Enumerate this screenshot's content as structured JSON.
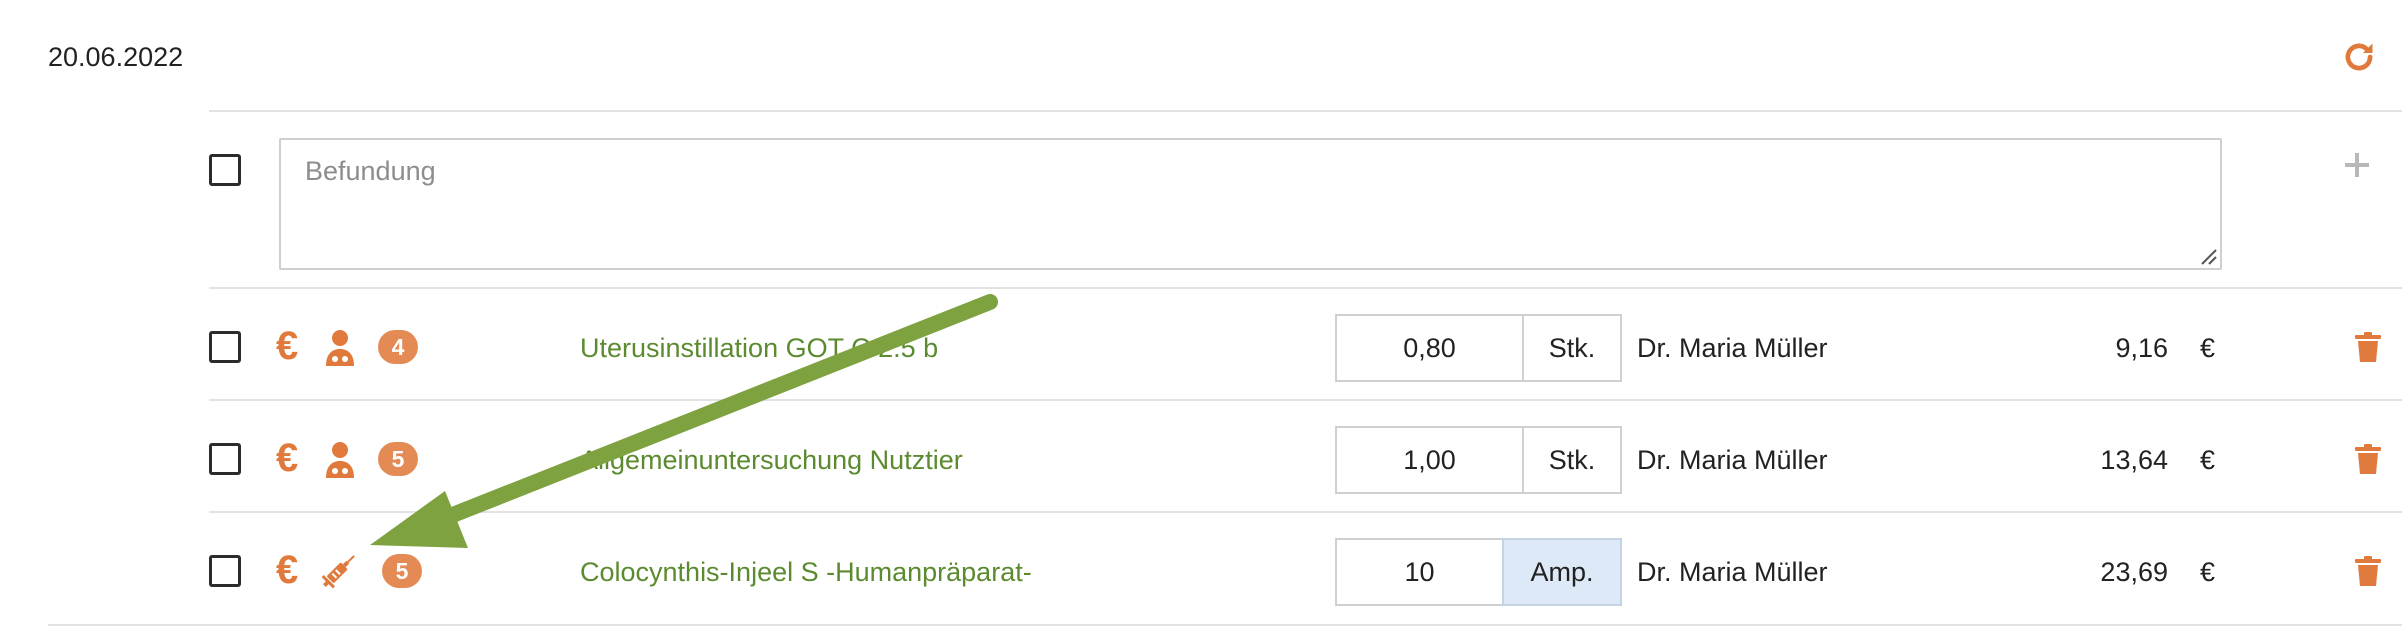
{
  "header": {
    "date": "20.06.2022",
    "refresh_icon": "refresh-icon"
  },
  "findings": {
    "placeholder": "Befundung",
    "value": "",
    "add_icon": "plus-icon"
  },
  "rows": [
    {
      "icons": [
        "euro-icon",
        "veterinarian-icon"
      ],
      "badge": "4",
      "name": "Uterusinstillation GOT C 2.5 b",
      "quantity": "0,80",
      "unit": "Stk.",
      "doctor": "Dr. Maria Müller",
      "price": "9,16",
      "currency": "€"
    },
    {
      "icons": [
        "euro-icon",
        "veterinarian-icon"
      ],
      "badge": "5",
      "name": "Allgemeinuntersuchung Nutztier",
      "quantity": "1,00",
      "unit": "Stk.",
      "doctor": "Dr. Maria Müller",
      "price": "13,64",
      "currency": "€"
    },
    {
      "icons": [
        "euro-icon",
        "syringe-icon"
      ],
      "badge": "5",
      "name": "Colocynthis-Injeel S -Humanpräparat-",
      "quantity": "10",
      "unit": "Amp.",
      "doctor": "Dr. Maria Müller",
      "price": "23,69",
      "currency": "€"
    }
  ],
  "symbols": {
    "euro": "€"
  },
  "colors": {
    "accent_orange": "#e07a3c",
    "badge_orange": "#e48a55",
    "service_green": "#5b8a2f",
    "arrow_green": "#7fa240",
    "unit_highlight": "#dde9f6"
  }
}
